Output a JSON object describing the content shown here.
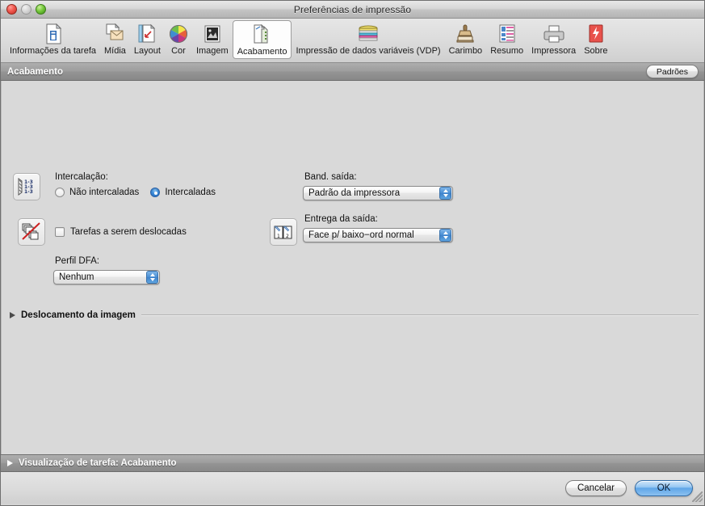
{
  "window": {
    "title": "Preferências de impressão",
    "traffic_lights": [
      "close-button",
      "minimize-button",
      "zoom-button"
    ]
  },
  "toolbar": {
    "items": [
      {
        "label": "Informações da tarefa",
        "icon": "job-info-icon",
        "selected": false
      },
      {
        "label": "Mídia",
        "icon": "media-icon",
        "selected": false
      },
      {
        "label": "Layout",
        "icon": "layout-icon",
        "selected": false
      },
      {
        "label": "Cor",
        "icon": "color-wheel-icon",
        "selected": false
      },
      {
        "label": "Imagem",
        "icon": "image-icon",
        "selected": false
      },
      {
        "label": "Acabamento",
        "icon": "finishing-icon",
        "selected": true
      },
      {
        "label": "Impressão de dados variáveis (VDP)",
        "icon": "vdp-icon",
        "selected": false
      },
      {
        "label": "Carimbo",
        "icon": "stamp-icon",
        "selected": false
      },
      {
        "label": "Resumo",
        "icon": "summary-icon",
        "selected": false
      },
      {
        "label": "Impressora",
        "icon": "printer-icon",
        "selected": false
      },
      {
        "label": "Sobre",
        "icon": "about-icon",
        "selected": false
      }
    ]
  },
  "section": {
    "title": "Acabamento",
    "defaults_button": "Padrões"
  },
  "finishing": {
    "collation": {
      "icon": "collation-icon",
      "label": "Intercalação:",
      "options": [
        {
          "label": "Não intercaladas",
          "selected": false
        },
        {
          "label": "Intercaladas",
          "selected": true
        }
      ]
    },
    "offset": {
      "icon": "offset-jobs-disabled-icon",
      "label": "Tarefas a serem deslocadas",
      "checked": false
    },
    "dfa_profile": {
      "label": "Perfil DFA:",
      "value": "Nenhum"
    },
    "output_tray": {
      "label": "Band. saída:",
      "value": "Padrão da impressora"
    },
    "output_delivery": {
      "icon": "output-delivery-icon",
      "label": "Entrega da saída:",
      "value": "Face p/ baixo−ord normal"
    },
    "image_shift": {
      "label": "Deslocamento da imagem",
      "expanded": false
    }
  },
  "preview": {
    "label": "Visualização de tarefa: Acabamento",
    "expanded": false
  },
  "footer": {
    "cancel_label": "Cancelar",
    "ok_label": "OK"
  },
  "colors": {
    "accent_blue": "#3c8ddb",
    "default_button_blue": "#5ea6e8",
    "section_bar": "#949494",
    "window_bg": "#d9d9d9"
  }
}
